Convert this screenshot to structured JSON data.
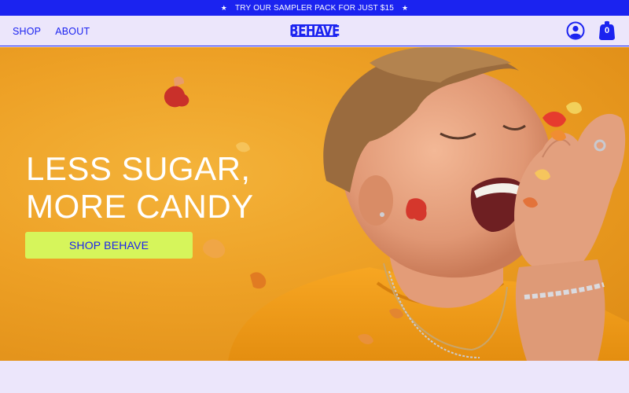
{
  "announcement": {
    "text": "TRY OUR SAMPLER PACK FOR JUST $15",
    "star": "★"
  },
  "nav": {
    "items": [
      {
        "label": "SHOP"
      },
      {
        "label": "ABOUT"
      }
    ]
  },
  "brand": {
    "logo_text": "BEHAVE"
  },
  "header_icons": {
    "account_icon": "user-circle-icon",
    "cart_icon": "bag-icon",
    "cart_count": "0"
  },
  "hero": {
    "headline_line1": "LESS SUGAR,",
    "headline_line2": "MORE CANDY",
    "cta_label": "SHOP BEHAVE"
  },
  "colors": {
    "primary_blue": "#1B23F0",
    "background_lavender": "#ECE6FB",
    "cta_lime": "#D6F55B",
    "hero_orange": "#EDA025"
  }
}
